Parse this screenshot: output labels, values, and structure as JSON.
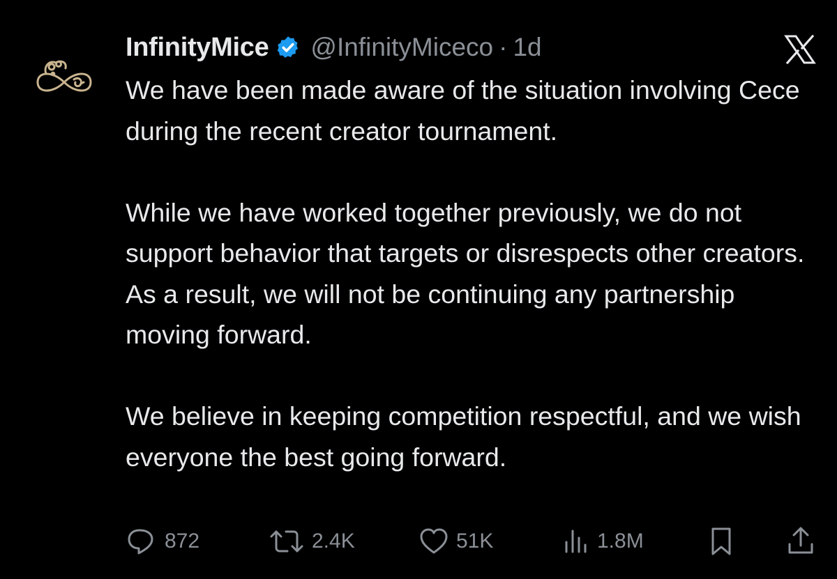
{
  "post": {
    "display_name": "InfinityMice",
    "handle": "@InfinityMiceco",
    "separator": "·",
    "time": "1d",
    "paragraphs": [
      "We have been made aware of the situation involving Cece during the recent creator tournament.",
      "While we have worked together previously, we do not support behavior that targets or disrespects other creators. As a result, we will not be continuing any partnership moving forward.",
      "We believe in keeping competition respectful, and we wish everyone the best going forward."
    ]
  },
  "actions": {
    "replies": "872",
    "reposts": "2.4K",
    "likes": "51K",
    "views": "1.8M"
  },
  "icons": {
    "avatar": "mouse-infinity-logo",
    "verified": "verified-badge-icon",
    "platform": "x-logo-icon",
    "reply": "reply-icon",
    "repost": "repost-icon",
    "like": "heart-icon",
    "views": "views-chart-icon",
    "bookmark": "bookmark-icon",
    "share": "share-icon"
  },
  "colors": {
    "background": "#000000",
    "text": "#e7e9ea",
    "muted": "#8b9097",
    "verified": "#1d9bf0",
    "avatar_gold": "#c9b48f"
  }
}
